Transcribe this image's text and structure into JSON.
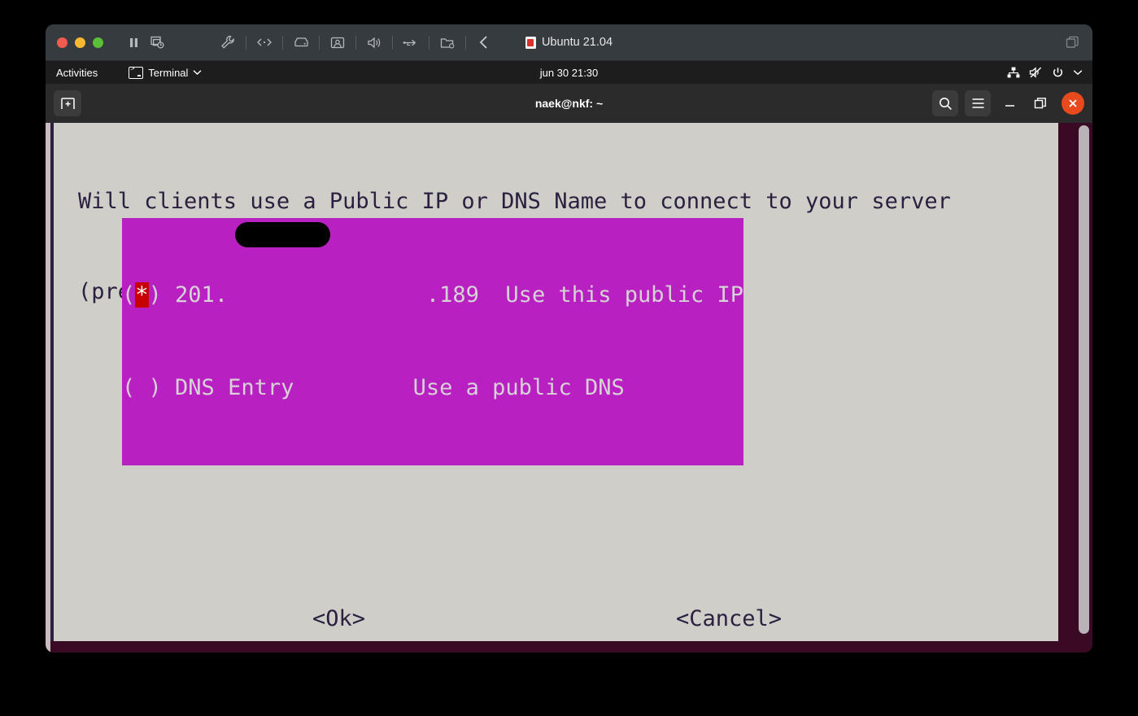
{
  "vm_window": {
    "title": "Ubuntu 21.04",
    "title_icon": "vm-file-icon",
    "traffic_lights": [
      "close",
      "minimize",
      "zoom"
    ],
    "toolbar_icons": [
      "pause-icon",
      "snapshot-icon",
      "tools-icon",
      "network-icon",
      "disk-icon",
      "display-icon",
      "sound-icon",
      "usb-icon",
      "shared-folder-icon",
      "back-chevron-icon"
    ],
    "restore_icon": "restore-window-icon"
  },
  "gnome_bar": {
    "activities": "Activities",
    "app_menu": "Terminal",
    "app_menu_icon": "terminal-app-icon",
    "app_menu_chevron": "chevron-down-icon",
    "clock": "jun 30  21:30",
    "tray_icons": [
      "network-wired-icon",
      "volume-muted-icon",
      "power-icon",
      "chevron-down-icon"
    ]
  },
  "terminal_window": {
    "title": "naek@nkf: ~",
    "new_tab_icon": "new-tab-icon",
    "search_icon": "search-icon",
    "menu_icon": "hamburger-menu-icon",
    "minimize_icon": "minimize-icon",
    "maximize_icon": "maximize-icon",
    "close_icon": "close-icon"
  },
  "dialog": {
    "question_line1": "Will clients use a Public IP or DNS Name to connect to your server",
    "question_line2": "(press space to select)?",
    "options": [
      {
        "marker_open": "(",
        "marker_state": "*",
        "marker_close": ")",
        "label_prefix": "201.",
        "label_redacted": true,
        "label_suffix": ".189",
        "description": "Use this public IP",
        "selected": true
      },
      {
        "marker_open": "(",
        "marker_state": " ",
        "marker_close": ")",
        "label": "DNS Entry",
        "description": "Use a public DNS",
        "selected": false
      }
    ],
    "row1_text": "( ) 201.               .189  Use this public IP",
    "row2_text": "( ) DNS Entry         Use a public DNS",
    "ok_button": "<Ok>",
    "cancel_button": "<Cancel>",
    "colors": {
      "background": "#d0cec9",
      "text": "#2b2040",
      "highlight": "#b920c2",
      "cursor": "#c80000",
      "terminal_background": "#3a0a24"
    }
  }
}
